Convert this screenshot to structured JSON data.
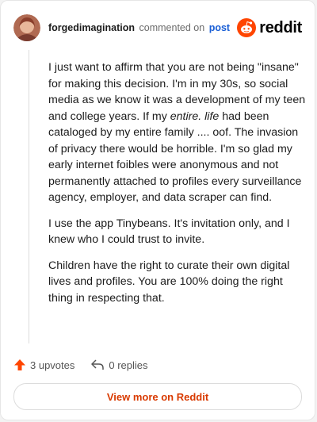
{
  "header": {
    "username": "forgedimagination",
    "action": "commented on",
    "post_link": "post",
    "brand": "reddit"
  },
  "comment": {
    "p1_part1": "I just want to affirm that you are not being \"insane\" for making this decision. I'm in my 30s, so social media as we know it was a development of my teen and college years. If my ",
    "p1_emph": "entire. life",
    "p1_part2": " had been cataloged by my entire family .... oof. The invasion of privacy there would be horrible. I'm so glad my early internet foibles were anonymous and not permanently attached to profiles every surveillance agency, employer, and data scraper can find.",
    "p2": "I use the app Tinybeans. It's invitation only, and I knew who I could trust to invite.",
    "p3": "Children have the right to curate their own digital lives and profiles. You are 100% doing the right thing in respecting that."
  },
  "footer": {
    "upvotes": "3 upvotes",
    "replies": "0 replies"
  },
  "view_more": "View more on Reddit",
  "colors": {
    "accent": "#d93a00",
    "upvote_arrow": "#ff4500",
    "link": "#1a5fd6"
  },
  "icons": [
    "upvote-arrow-icon",
    "reply-arrow-icon",
    "reddit-snoo-icon"
  ]
}
